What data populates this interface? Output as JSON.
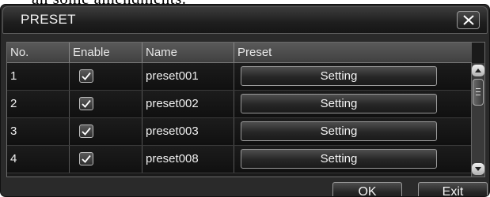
{
  "background_text": "an some amendments.",
  "dialog": {
    "title": "PRESET",
    "close_icon": "close-x-icon"
  },
  "table": {
    "columns": [
      "No.",
      "Enable",
      "Name",
      "Preset"
    ],
    "rows": [
      {
        "no": "1",
        "enabled": true,
        "name": "preset001",
        "button": "Setting"
      },
      {
        "no": "2",
        "enabled": true,
        "name": "preset002",
        "button": "Setting"
      },
      {
        "no": "3",
        "enabled": true,
        "name": "preset003",
        "button": "Setting"
      },
      {
        "no": "4",
        "enabled": true,
        "name": "preset008",
        "button": "Setting"
      }
    ]
  },
  "footer": {
    "ok_label": "OK",
    "exit_label": "Exit"
  },
  "colors": {
    "dialog_bg": "#2a2a2a",
    "header_bg": "#505050",
    "text": "#f0f0f0"
  }
}
